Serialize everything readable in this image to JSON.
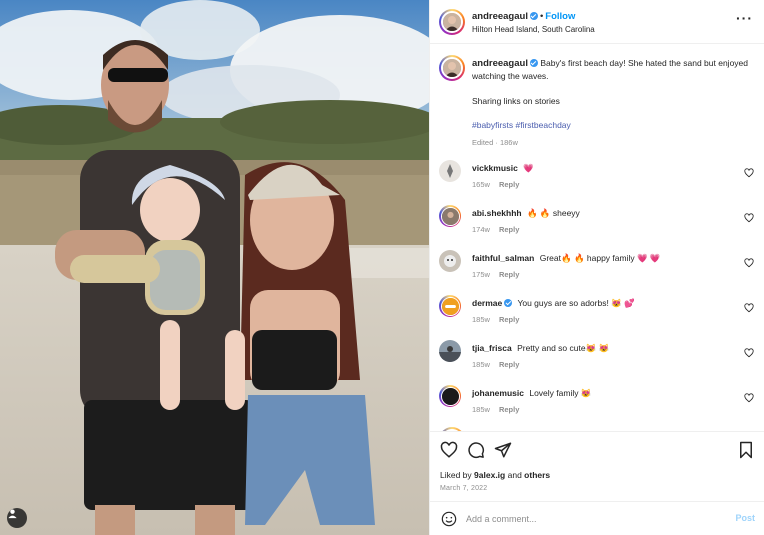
{
  "post": {
    "username": "andreeagaul",
    "verified": true,
    "follow_label": "Follow",
    "location": "Hilton Head Island, South Carolina",
    "more_icon": "more-horizontal-icon"
  },
  "caption": {
    "username": "andreeagaul",
    "text": "Baby's first beach day! She hated the sand but enjoyed watching the waves.",
    "line2": "Sharing links on stories",
    "hashtags": [
      "#babyfirsts",
      "#firstbeachday"
    ],
    "edited": "Edited",
    "separator": "·",
    "time": "186w"
  },
  "comments": [
    {
      "username": "vickkmusic",
      "verified": false,
      "text": "💗",
      "time": "165w",
      "reply": "Reply",
      "avatar_color": "#e8e4df"
    },
    {
      "username": "abi.shekhhh",
      "verified": false,
      "text": "🔥 🔥 sheeyy",
      "time": "174w",
      "reply": "Reply",
      "avatar_color": "#8a7a6c"
    },
    {
      "username": "faithful_salman",
      "verified": false,
      "text": "Great🔥 🔥 happy family 💗 💗",
      "time": "175w",
      "reply": "Reply",
      "avatar_color": "#c9c2b8"
    },
    {
      "username": "dermae",
      "verified": true,
      "text": "You guys are so adorbs! 😻 💕",
      "time": "185w",
      "reply": "Reply",
      "avatar_color": "#f0a020"
    },
    {
      "username": "tjia_frisca",
      "verified": false,
      "text": "Pretty and so cute😻 😻",
      "time": "185w",
      "reply": "Reply",
      "avatar_color": "#4a5058"
    },
    {
      "username": "johanemusic",
      "verified": false,
      "text": "Lovely family 😻",
      "time": "185w",
      "reply": "Reply",
      "avatar_color": "#1a1a1a"
    }
  ],
  "actions": {
    "like_icon": "heart-icon",
    "comment_icon": "comment-icon",
    "share_icon": "paper-plane-icon",
    "save_icon": "bookmark-icon"
  },
  "likes": {
    "prefix": "Liked by",
    "user": "9alex.ig",
    "and": "and",
    "others": "others"
  },
  "date": "March 7, 2022",
  "add_comment": {
    "placeholder": "Add a comment...",
    "post_label": "Post",
    "emoji_icon": "smiley-icon"
  },
  "colors": {
    "accent": "#0095f6",
    "hashtag": "#4a5dae",
    "muted": "#8e8e8e",
    "verified": "#3897f0"
  }
}
